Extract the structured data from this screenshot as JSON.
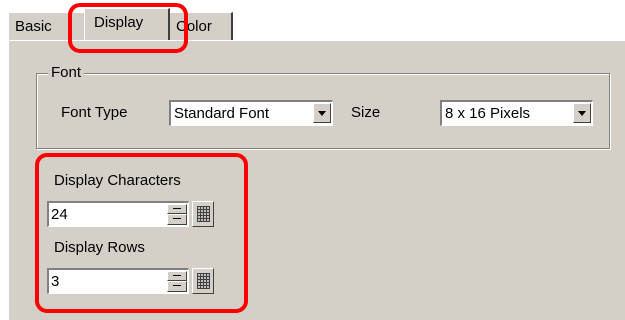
{
  "tabs": [
    {
      "label": "Basic"
    },
    {
      "label": "Display"
    },
    {
      "label": "Color"
    }
  ],
  "font_group": {
    "legend": "Font",
    "font_type_label": "Font Type",
    "font_type_value": "Standard Font",
    "size_label": "Size",
    "size_value": "8 x 16 Pixels"
  },
  "display": {
    "characters_label": "Display Characters",
    "characters_value": "24",
    "rows_label": "Display Rows",
    "rows_value": "3"
  },
  "colors": {
    "panel_bg": "#d4d0c8",
    "highlight": "#ff0000"
  }
}
